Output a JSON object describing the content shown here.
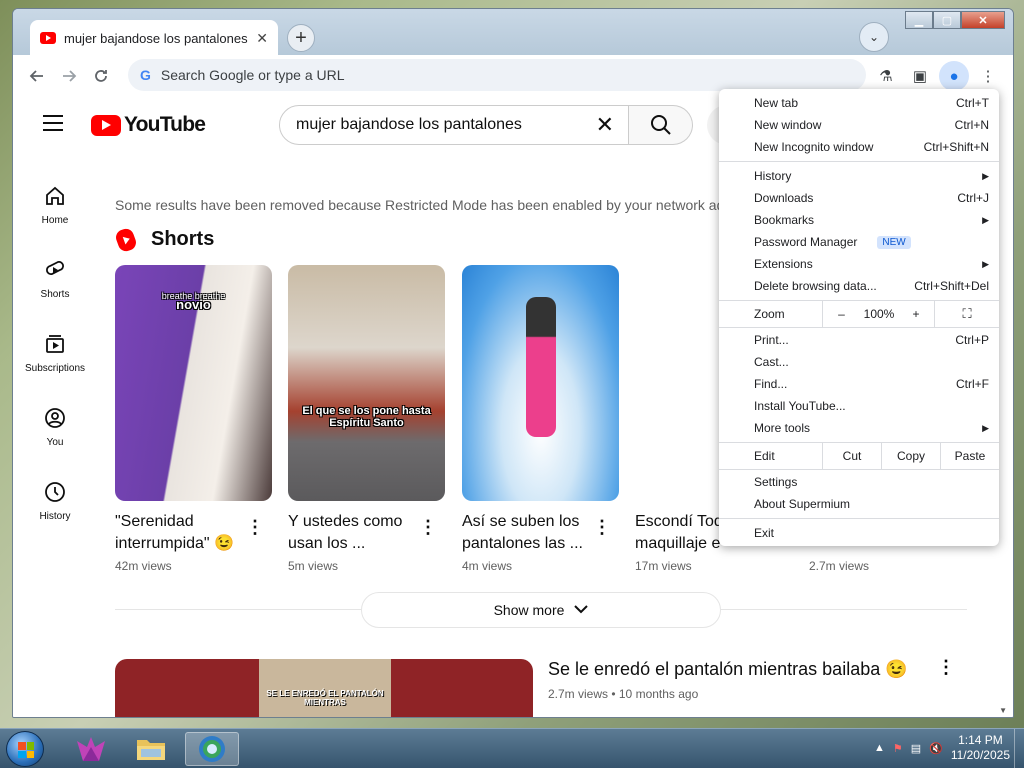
{
  "browser": {
    "tab": {
      "title": "mujer bajandose los pantalones"
    },
    "omnibox": {
      "placeholder": "Search Google or type a URL"
    },
    "window_controls": {
      "minimize": "▁",
      "maximize": "▢",
      "close": "✕"
    }
  },
  "youtube": {
    "logo_text": "YouTube",
    "search": {
      "query": "mujer bajandose los pantalones"
    },
    "guide": [
      {
        "label": "Home",
        "icon": "home-icon"
      },
      {
        "label": "Shorts",
        "icon": "shorts-icon"
      },
      {
        "label": "Subscriptions",
        "icon": "subscriptions-icon"
      },
      {
        "label": "You",
        "icon": "you-icon"
      },
      {
        "label": "History",
        "icon": "history-icon"
      }
    ],
    "notice": "Some results have been removed because Restricted Mode has been enabled by your network adr",
    "shorts_title": "Shorts",
    "shorts": [
      {
        "title": "\"Serenidad interrumpida\" 😉",
        "views": "42m views",
        "caption": "novio",
        "caption_top": "breathe breathe"
      },
      {
        "title": "Y ustedes como usan los ...",
        "views": "5m views",
        "caption": "El que se los pone hasta Espíritu Santo"
      },
      {
        "title": "Así se suben los pantalones las ...",
        "views": "4m views",
        "caption": ""
      },
      {
        "title": "Escondí Tod maquillaje e",
        "views": "17m views",
        "caption": ""
      },
      {
        "title": "",
        "views": "2.7m views",
        "caption": ""
      }
    ],
    "show_more": "Show more",
    "video": {
      "title": "Se le enredó el pantalón mientras bailaba 😉",
      "meta": "2.7m views • 10 months ago",
      "thumb_caption": "SE LE ENREDÓ EL PANTALÓN MIENTRAS"
    }
  },
  "menu": {
    "new_tab": {
      "label": "New tab",
      "shortcut": "Ctrl+T"
    },
    "new_window": {
      "label": "New window",
      "shortcut": "Ctrl+N"
    },
    "new_incognito": {
      "label": "New Incognito window",
      "shortcut": "Ctrl+Shift+N"
    },
    "history": {
      "label": "History"
    },
    "downloads": {
      "label": "Downloads",
      "shortcut": "Ctrl+J"
    },
    "bookmarks": {
      "label": "Bookmarks"
    },
    "password_manager": {
      "label": "Password Manager",
      "badge": "NEW"
    },
    "extensions": {
      "label": "Extensions"
    },
    "delete_browsing": {
      "label": "Delete browsing data...",
      "shortcut": "Ctrl+Shift+Del"
    },
    "zoom": {
      "label": "Zoom",
      "minus": "–",
      "value": "100%",
      "plus": "+"
    },
    "print": {
      "label": "Print...",
      "shortcut": "Ctrl+P"
    },
    "cast": {
      "label": "Cast..."
    },
    "find": {
      "label": "Find...",
      "shortcut": "Ctrl+F"
    },
    "install": {
      "label": "Install YouTube..."
    },
    "more_tools": {
      "label": "More tools"
    },
    "edit": {
      "label": "Edit",
      "cut": "Cut",
      "copy": "Copy",
      "paste": "Paste"
    },
    "settings": {
      "label": "Settings"
    },
    "about": {
      "label": "About Supermium"
    },
    "exit": {
      "label": "Exit"
    }
  },
  "taskbar": {
    "time": "1:14 PM",
    "date": "11/20/2025"
  }
}
